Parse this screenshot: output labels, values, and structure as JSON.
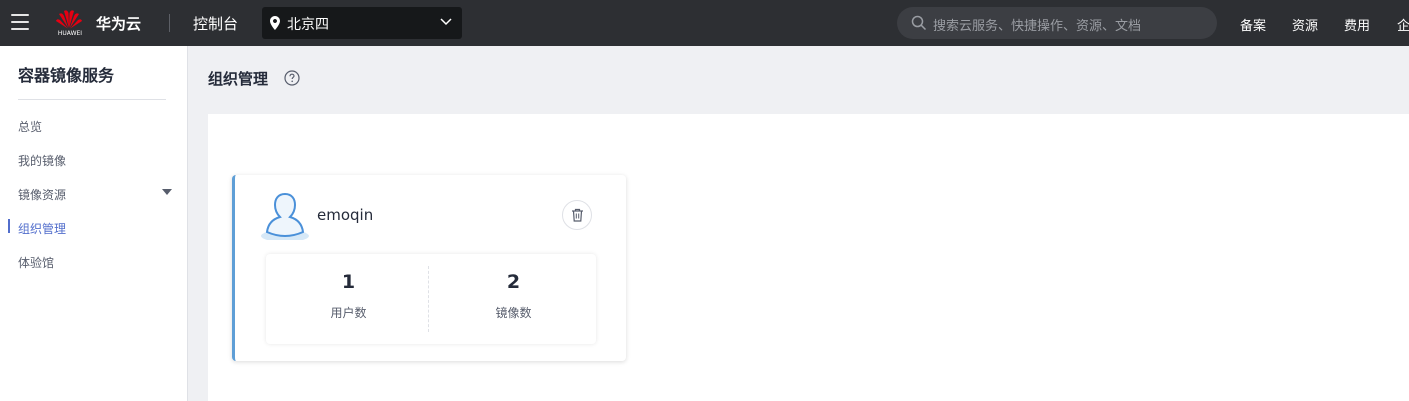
{
  "topbar": {
    "brand": "华为云",
    "logo_text": "HUAWEI",
    "console": "控制台",
    "region": "北京四",
    "search_placeholder": "搜索云服务、快捷操作、资源、文档",
    "links": [
      "备案",
      "资源",
      "费用",
      "企"
    ]
  },
  "sidebar": {
    "title": "容器镜像服务",
    "items": [
      {
        "label": "总览"
      },
      {
        "label": "我的镜像"
      },
      {
        "label": "镜像资源"
      },
      {
        "label": "组织管理"
      },
      {
        "label": "体验馆"
      }
    ],
    "active_index": 3
  },
  "main": {
    "title": "组织管理",
    "org": {
      "name": "emoqin",
      "stats": [
        {
          "value": "1",
          "label": "用户数"
        },
        {
          "value": "2",
          "label": "镜像数"
        }
      ]
    }
  },
  "colors": {
    "topbar_bg": "#2d2f33",
    "accent": "#526ecc",
    "card_accent": "#5e9ed6"
  }
}
